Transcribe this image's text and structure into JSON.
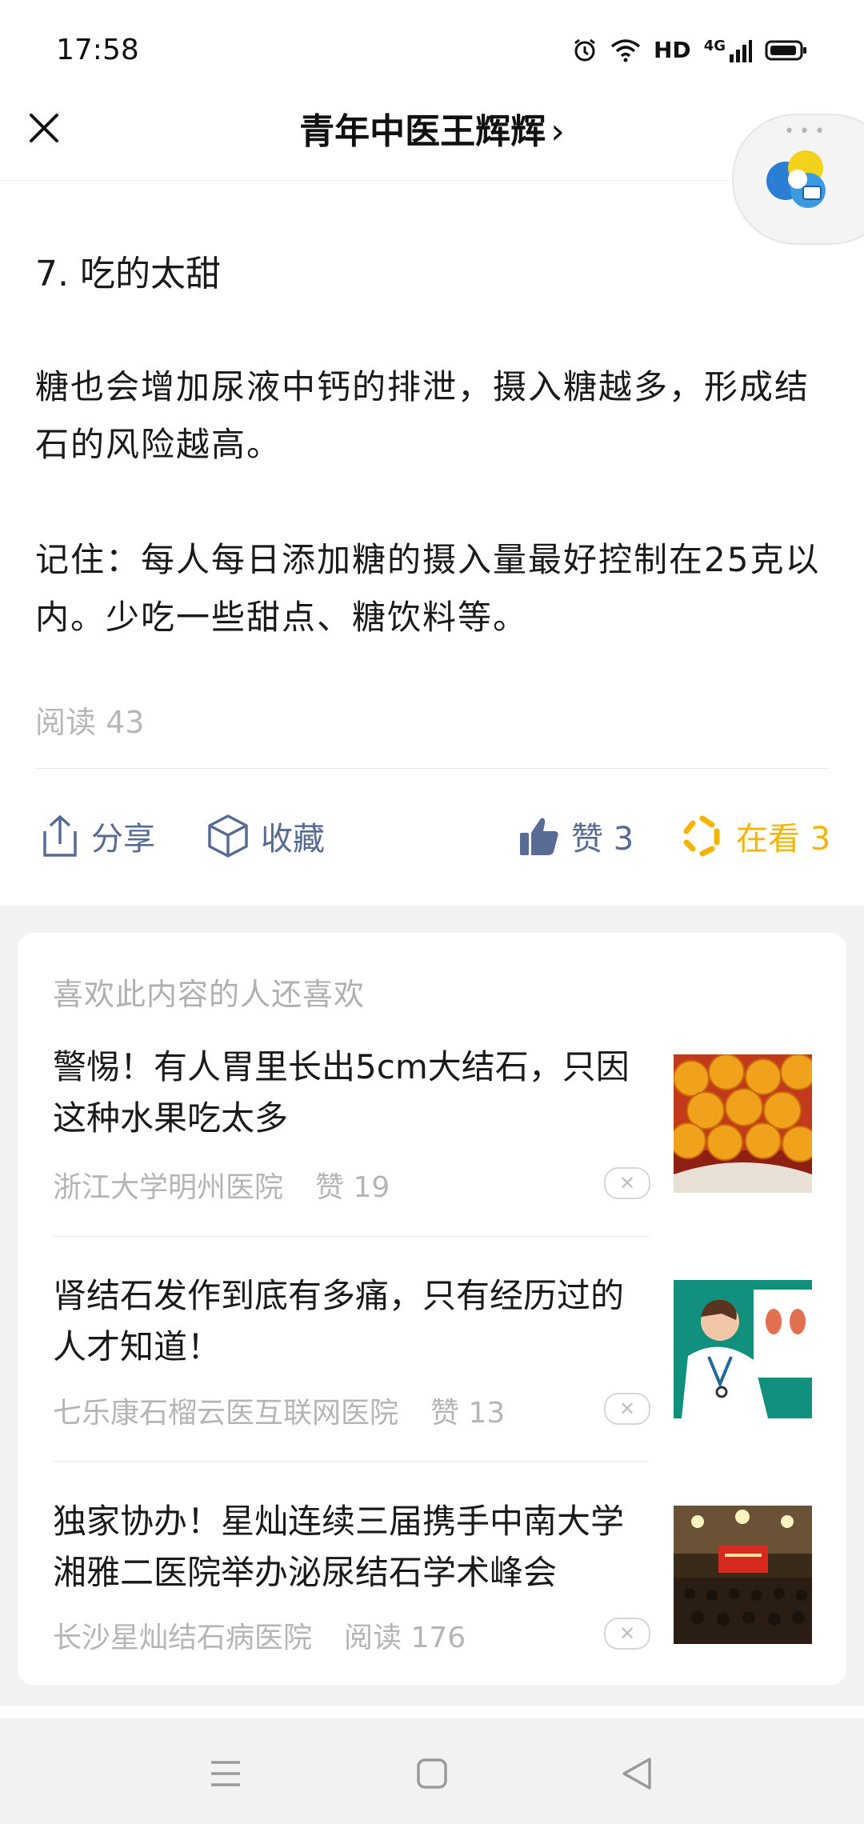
{
  "status_bar": {
    "time": "17:58",
    "hd_label": "HD",
    "network_label": "4G"
  },
  "header": {
    "title": "青年中医王辉辉",
    "chevron": "›"
  },
  "article": {
    "heading": "7. 吃的太甜",
    "paragraph_1": "糖也会增加尿液中钙的排泄，摄入糖越多，形成结石的风险越高。",
    "paragraph_2": "记住：每人每日添加糖的摄入量最好控制在25克以内。少吃一些甜点、糖饮料等。",
    "read_count": "阅读 43"
  },
  "actions": {
    "share_label": "分享",
    "favorite_label": "收藏",
    "like_label": "赞 3",
    "watching_label": "在看 3"
  },
  "recommend": {
    "section_title": "喜欢此内容的人还喜欢",
    "items": [
      {
        "title": "警惕！有人胃里长出5cm大结石，只因这种水果吃太多",
        "source": "浙江大学明州医院",
        "stat": "赞 19",
        "image": "persimmons-photo"
      },
      {
        "title": "肾结石发作到底有多痛，只有经历过的人才知道！",
        "source": "七乐康石榴云医互联网医院",
        "stat": "赞 13",
        "image": "doctor-kidney-illustration"
      },
      {
        "title": "独家协办！星灿连续三届携手中南大学湘雅二医院举办泌尿结石学术峰会",
        "source": "长沙星灿结石病医院",
        "stat": "阅读 176",
        "image": "conference-hall-photo"
      }
    ]
  },
  "colors": {
    "link_blue": "#576b95",
    "watch_yellow": "#f5b400",
    "muted_grey": "#b5b5b5"
  }
}
